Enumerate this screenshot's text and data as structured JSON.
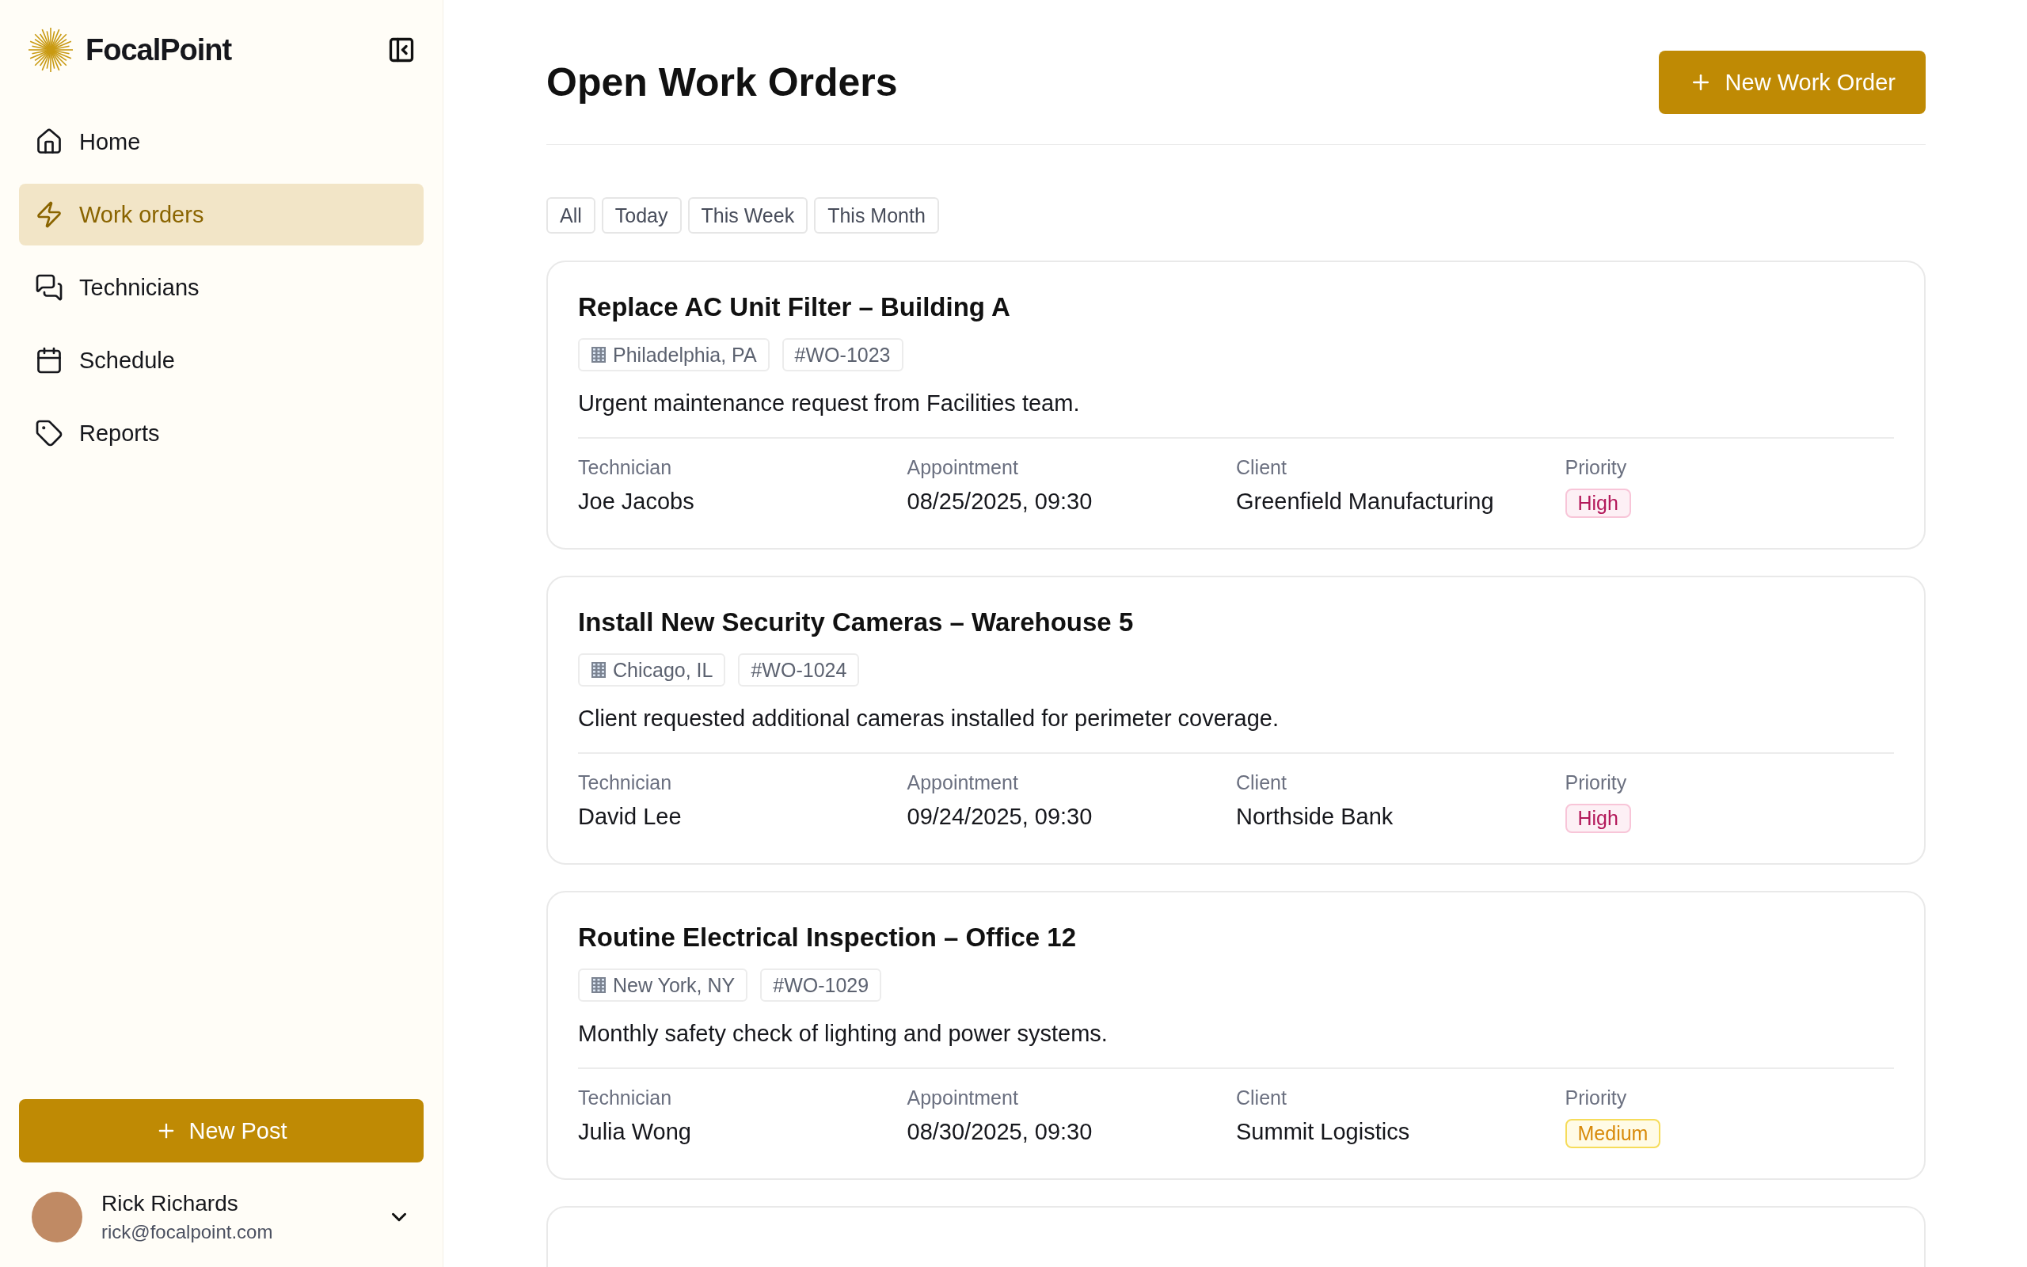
{
  "brand": {
    "name": "FocalPoint"
  },
  "nav": [
    {
      "label": "Home",
      "selected": false
    },
    {
      "label": "Work orders",
      "selected": true
    },
    {
      "label": "Technicians",
      "selected": false
    },
    {
      "label": "Schedule",
      "selected": false
    },
    {
      "label": "Reports",
      "selected": false
    }
  ],
  "new_post_button": "New Post",
  "user": {
    "name": "Rick Richards",
    "email": "rick@focalpoint.com"
  },
  "page_title": "Open Work Orders",
  "new_work_order_button": "New Work Order",
  "filters": [
    "All",
    "Today",
    "This Week",
    "This Month"
  ],
  "work_orders": [
    {
      "title": "Replace AC Unit Filter – Building A",
      "location": "Philadelphia, PA",
      "id": "#WO-1023",
      "description": "Urgent maintenance request from Facilities team.",
      "fields": [
        {
          "label": "Technician",
          "value": "Joe Jacobs"
        },
        {
          "label": "Appointment",
          "value": "08/25/2025, 09:30"
        },
        {
          "label": "Client",
          "value": "Greenfield Manufacturing"
        }
      ],
      "priority": {
        "label": "Priority",
        "value": "High",
        "kind": "high"
      }
    },
    {
      "title": "Install New Security Cameras – Warehouse 5",
      "location": "Chicago, IL",
      "id": "#WO-1024",
      "description": "Client requested additional cameras installed for perimeter coverage.",
      "fields": [
        {
          "label": "Technician",
          "value": "David Lee"
        },
        {
          "label": "Appointment",
          "value": "09/24/2025, 09:30"
        },
        {
          "label": "Client",
          "value": "Northside Bank"
        }
      ],
      "priority": {
        "label": "Priority",
        "value": "High",
        "kind": "high"
      }
    },
    {
      "title": "Routine Electrical Inspection – Office 12",
      "location": "New York, NY",
      "id": "#WO-1029",
      "description": "Monthly safety check of lighting and power systems.",
      "fields": [
        {
          "label": "Technician",
          "value": "Julia Wong"
        },
        {
          "label": "Appointment",
          "value": "08/30/2025, 09:30"
        },
        {
          "label": "Client",
          "value": "Summit Logistics"
        }
      ],
      "priority": {
        "label": "Priority",
        "value": "Medium",
        "kind": "medium"
      }
    }
  ]
}
